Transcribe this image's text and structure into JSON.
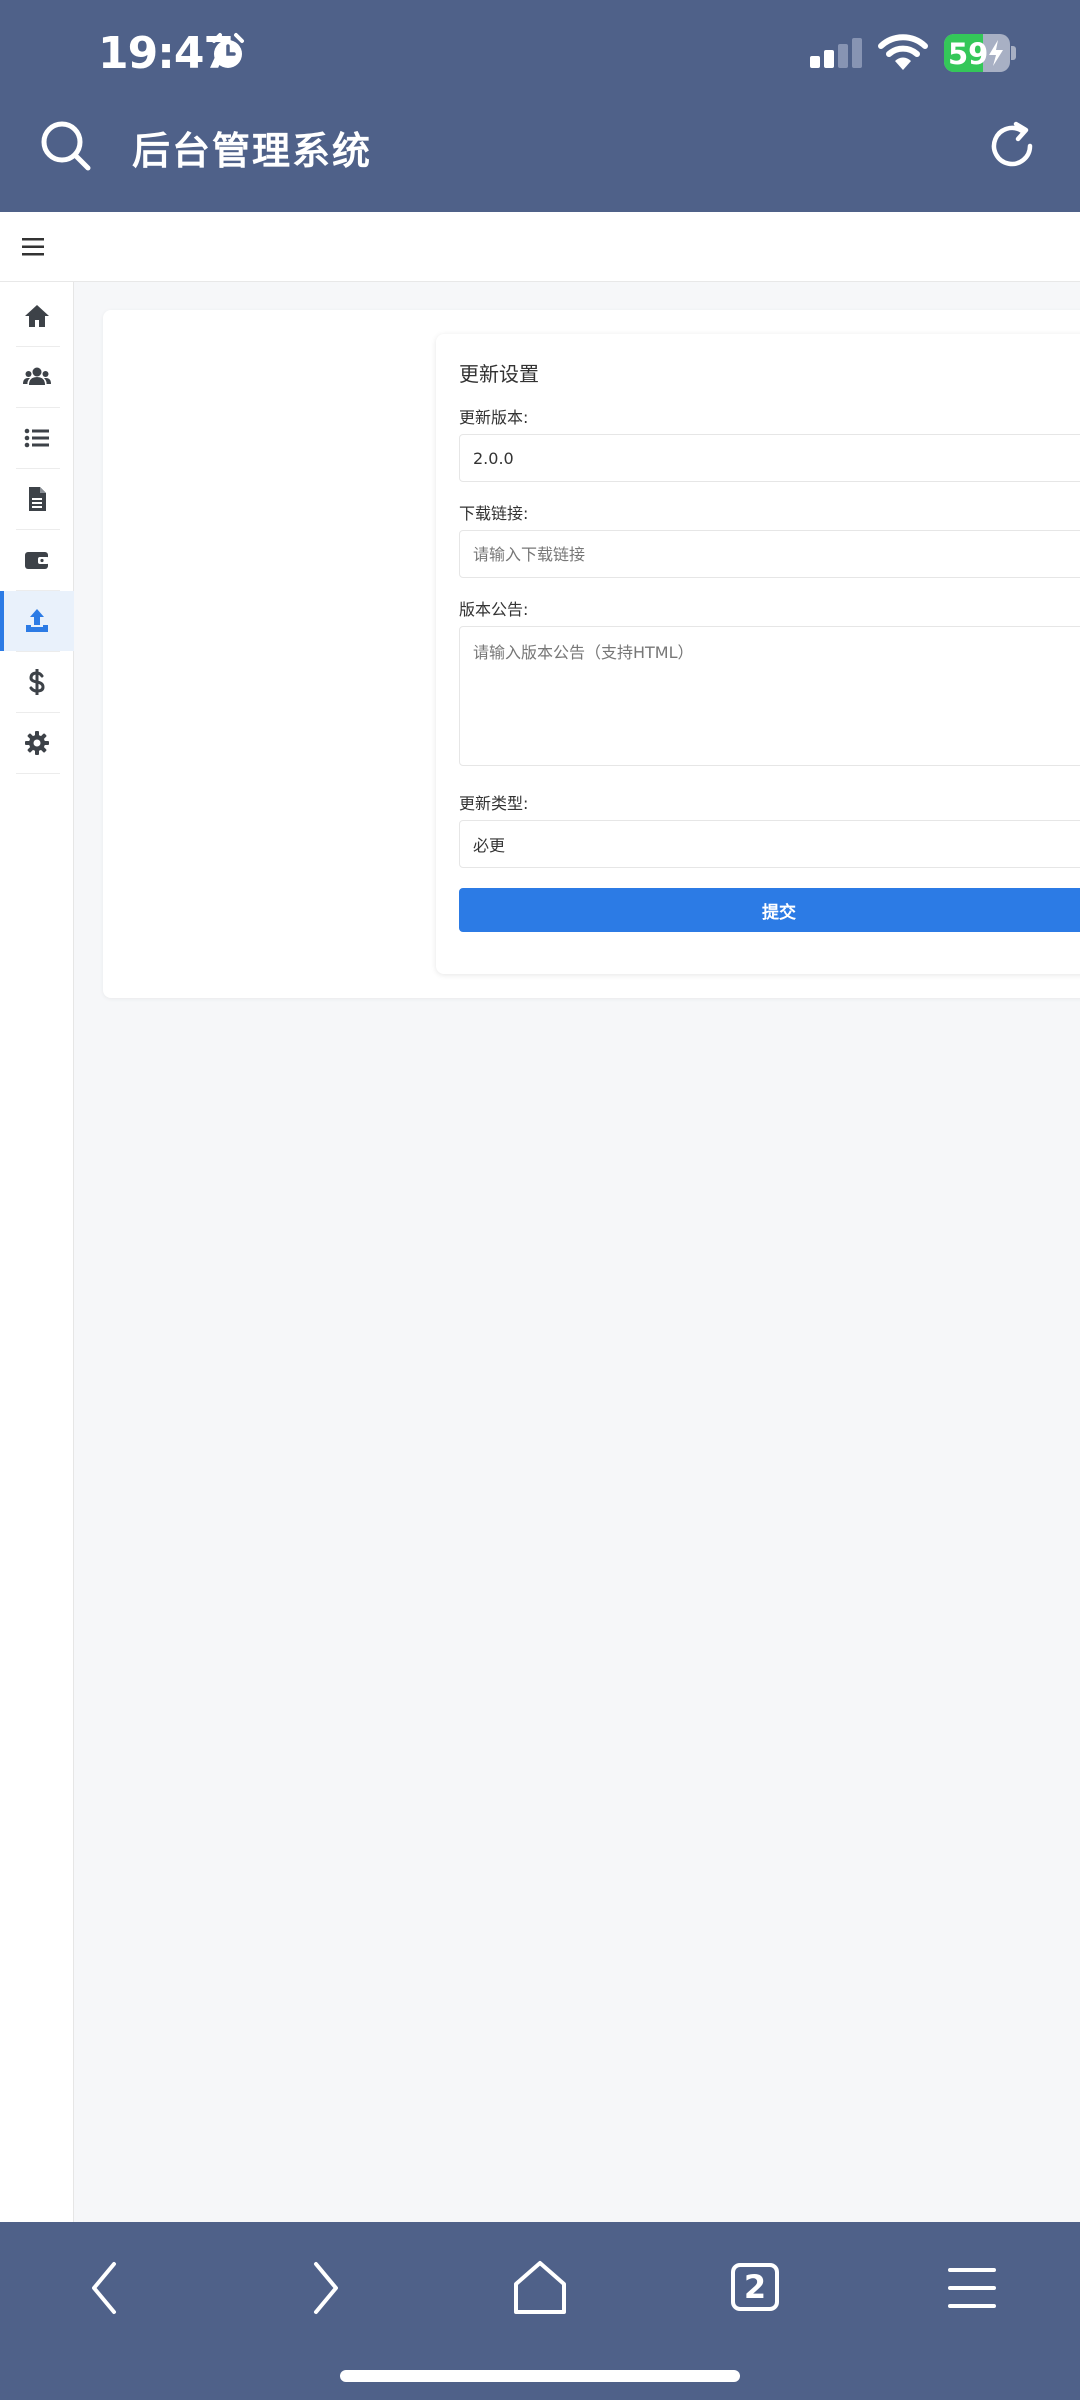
{
  "status_bar": {
    "time": "19:47",
    "battery_level": "59",
    "battery_fraction": 0.59
  },
  "browser": {
    "title": "后台管理系统",
    "tab_count": "2"
  },
  "sidebar": {
    "items": [
      {
        "name": "home",
        "icon": "home-icon",
        "active": false
      },
      {
        "name": "users",
        "icon": "users-icon",
        "active": false
      },
      {
        "name": "list",
        "icon": "list-icon",
        "active": false
      },
      {
        "name": "document",
        "icon": "file-icon",
        "active": false
      },
      {
        "name": "wallet",
        "icon": "wallet-icon",
        "active": false
      },
      {
        "name": "update",
        "icon": "upload-icon",
        "active": true
      },
      {
        "name": "finance",
        "icon": "dollar-icon",
        "active": false
      },
      {
        "name": "settings",
        "icon": "gear-icon",
        "active": false
      }
    ]
  },
  "form": {
    "title": "更新设置",
    "version_label": "更新版本:",
    "version_value": "2.0.0",
    "link_label": "下载链接:",
    "link_placeholder": "请输入下载链接",
    "notice_label": "版本公告:",
    "notice_placeholder": "请输入版本公告（支持HTML）",
    "type_label": "更新类型:",
    "type_value": "必更",
    "submit_label": "提交"
  },
  "colors": {
    "browser_bar": "#4f6189",
    "accent": "#2c7be5",
    "battery": "#34c759",
    "page_bg": "#f6f7f9"
  }
}
